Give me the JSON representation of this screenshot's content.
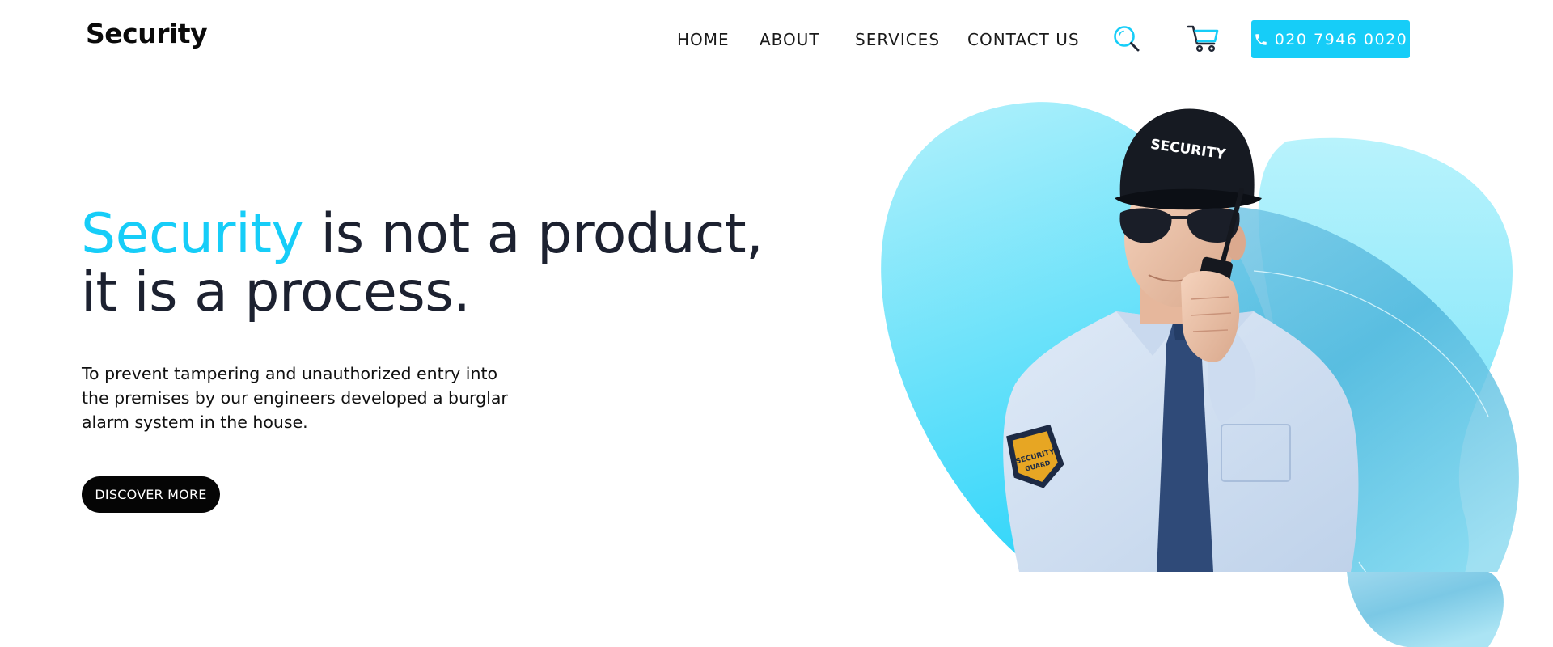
{
  "brand": {
    "name": "Security"
  },
  "nav": {
    "items": [
      {
        "label": "HOME"
      },
      {
        "label": "ABOUT"
      },
      {
        "label": "SERVICES"
      },
      {
        "label": "CONTACT US"
      }
    ],
    "search_icon": "search-icon",
    "cart_icon": "cart-icon",
    "phone_icon": "phone-icon",
    "phone_label": "020 7946 0020"
  },
  "hero": {
    "headline_accent": "Security",
    "headline_rest": " is not a product, it is a process.",
    "description": "To prevent tampering and unauthorized entry into the premises by our engineers developed a burglar alarm system in the house.",
    "cta_label": "DISCOVER MORE",
    "cap_text": "SECURITY",
    "badge_text": "SECURITY GUARD"
  },
  "colors": {
    "accent": "#16cdf8",
    "text_dark": "#1c2130",
    "button_dark": "#050505",
    "blob_light": "#aef0fb"
  }
}
